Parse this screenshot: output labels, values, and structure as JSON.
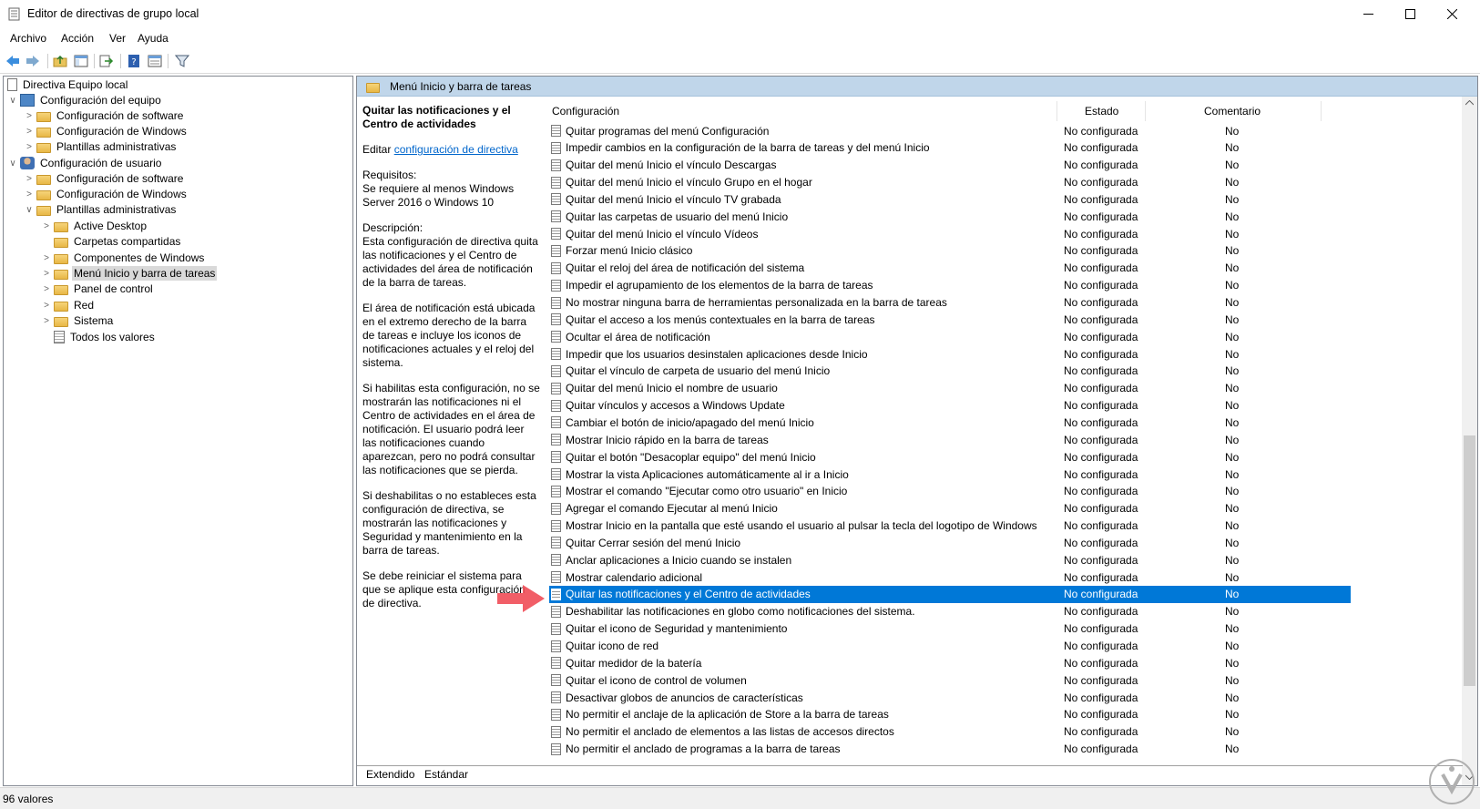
{
  "window": {
    "title": "Editor de directivas de grupo local"
  },
  "menu": [
    "Archivo",
    "Acción",
    "Ver",
    "Ayuda"
  ],
  "toolbar_icons": [
    "back-icon",
    "forward-icon",
    "up-folder-icon",
    "show-hide-tree-icon",
    "export-list-icon",
    "help-icon",
    "properties-icon",
    "filter-icon"
  ],
  "tree": {
    "root": "Directiva Equipo local",
    "computer": "Configuración del equipo",
    "comp_children": [
      "Configuración de software",
      "Configuración de Windows",
      "Plantillas administrativas"
    ],
    "user": "Configuración de usuario",
    "user_children": [
      "Configuración de software",
      "Configuración de Windows",
      "Plantillas administrativas"
    ],
    "admin_children": [
      "Active Desktop",
      "Carpetas compartidas",
      "Componentes de Windows",
      "Menú Inicio y barra de tareas",
      "Panel de control",
      "Red",
      "Sistema",
      "Todos los valores"
    ]
  },
  "right_header": "Menú Inicio y barra de tareas",
  "description": {
    "title": "Quitar las notificaciones y el Centro de actividades",
    "edit_prefix": "Editar",
    "edit_link": "configuración de directiva",
    "req_label": "Requisitos:",
    "req_text": "Se requiere al menos Windows Server 2016 o Windows 10",
    "desc_label": "Descripción:",
    "p1": "Esta configuración de directiva quita las notificaciones y el Centro de actividades del área de notificación de la barra de tareas.",
    "p2": "El área de notificación está ubicada en el extremo derecho de la barra de tareas e incluye los iconos de notificaciones actuales y el reloj del sistema.",
    "p3": "Si habilitas esta configuración, no se mostrarán las notificaciones ni el Centro de actividades en el área de notificación. El usuario podrá leer las notificaciones cuando aparezcan, pero no podrá consultar las notificaciones que se pierda.",
    "p4": "Si deshabilitas o no estableces esta configuración de directiva, se mostrarán las notificaciones y Seguridad y mantenimiento en la barra de tareas.",
    "p5": "Se debe reiniciar el sistema para que se aplique esta configuración de directiva."
  },
  "columns": {
    "config": "Configuración",
    "state": "Estado",
    "comment": "Comentario"
  },
  "rows": [
    "Quitar programas del menú Configuración",
    "Impedir cambios en la configuración de la barra de tareas y del menú Inicio",
    "Quitar del menú Inicio el vínculo Descargas",
    "Quitar del menú Inicio el vínculo Grupo en el hogar",
    "Quitar del menú Inicio el vínculo TV grabada",
    "Quitar las carpetas de usuario del menú Inicio",
    "Quitar del menú Inicio el vínculo Vídeos",
    "Forzar menú Inicio clásico",
    "Quitar el reloj del área de notificación del sistema",
    "Impedir el agrupamiento de los elementos de la barra de tareas",
    "No mostrar ninguna barra de herramientas personalizada en la barra de tareas",
    "Quitar el acceso a los menús contextuales en la barra de tareas",
    "Ocultar el área de notificación",
    "Impedir que los usuarios desinstalen aplicaciones desde Inicio",
    "Quitar el vínculo de carpeta de usuario del menú Inicio",
    "Quitar del menú Inicio el nombre de usuario",
    "Quitar vínculos y accesos a Windows Update",
    "Cambiar el botón de inicio/apagado del menú Inicio",
    "Mostrar Inicio rápido en la barra de tareas",
    "Quitar el botón \"Desacoplar equipo\" del menú Inicio",
    "Mostrar la vista Aplicaciones automáticamente al ir a Inicio",
    "Mostrar el comando \"Ejecutar como otro usuario\" en Inicio",
    "Agregar el comando Ejecutar al menú Inicio",
    "Mostrar Inicio en la pantalla que esté usando el usuario al pulsar la tecla del logotipo de Windows",
    "Quitar Cerrar sesión del menú Inicio",
    "Anclar aplicaciones a Inicio cuando se instalen",
    "Mostrar calendario adicional",
    "Quitar las notificaciones y el Centro de actividades",
    "Deshabilitar las notificaciones en globo como notificaciones del sistema.",
    "Quitar el icono de Seguridad y mantenimiento",
    "Quitar icono de red",
    "Quitar medidor de la batería",
    "Quitar el icono de control de volumen",
    "Desactivar globos de anuncios de características",
    "No permitir el anclaje de la aplicación de Store a la barra de tareas",
    "No permitir el anclado de elementos a las listas de accesos directos",
    "No permitir el anclado de programas a la barra de tareas"
  ],
  "row_state": "No configurada",
  "row_comment": "No",
  "selected_row": 27,
  "tabs": [
    "Extendido",
    "Estándar"
  ],
  "status": "96 valores"
}
